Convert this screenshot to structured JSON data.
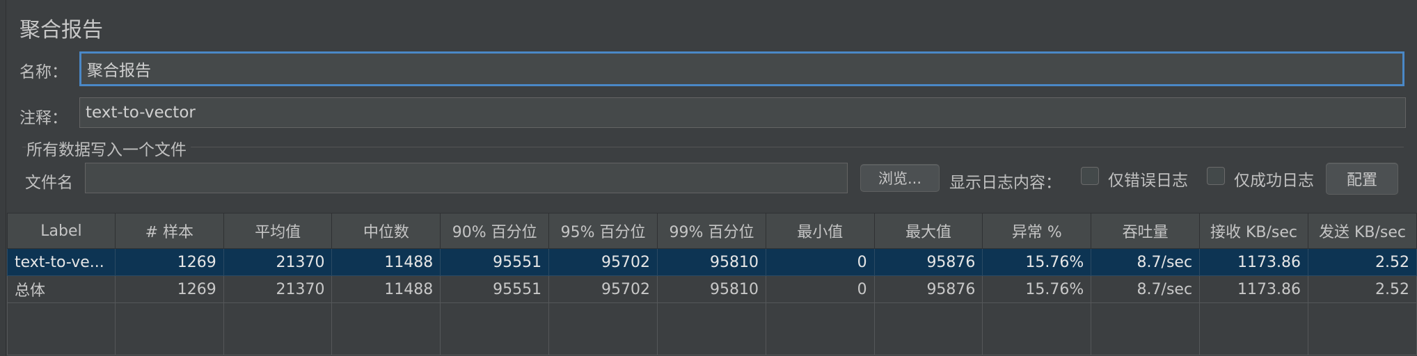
{
  "title": "聚合报告",
  "form": {
    "name_label": "名称：",
    "name_value": "聚合报告",
    "comment_label": "注释：",
    "comment_value": "text-to-vector"
  },
  "file_group": {
    "title": "所有数据写入一个文件",
    "filename_label": "文件名",
    "filename_value": "",
    "browse_label": "浏览...",
    "log_label": "显示日志内容：",
    "errors_only_label": "仅错误日志",
    "success_only_label": "仅成功日志",
    "config_label": "配置"
  },
  "table": {
    "headers": [
      "Label",
      "# 样本",
      "平均值",
      "中位数",
      "90% 百分位",
      "95% 百分位",
      "99% 百分位",
      "最小值",
      "最大值",
      "异常 %",
      "吞吐量",
      "接收 KB/sec",
      "发送 KB/sec"
    ],
    "rows": [
      [
        "text-to-ve...",
        "1269",
        "21370",
        "11488",
        "95551",
        "95702",
        "95810",
        "0",
        "95876",
        "15.76%",
        "8.7/sec",
        "1173.86",
        "2.52"
      ],
      [
        "总体",
        "1269",
        "21370",
        "11488",
        "95551",
        "95702",
        "95810",
        "0",
        "95876",
        "15.76%",
        "8.7/sec",
        "1173.86",
        "2.52"
      ]
    ]
  },
  "colors": {
    "background": "#3c3f41",
    "focus_border": "#4a88c7",
    "selected_row": "#0d3453"
  }
}
